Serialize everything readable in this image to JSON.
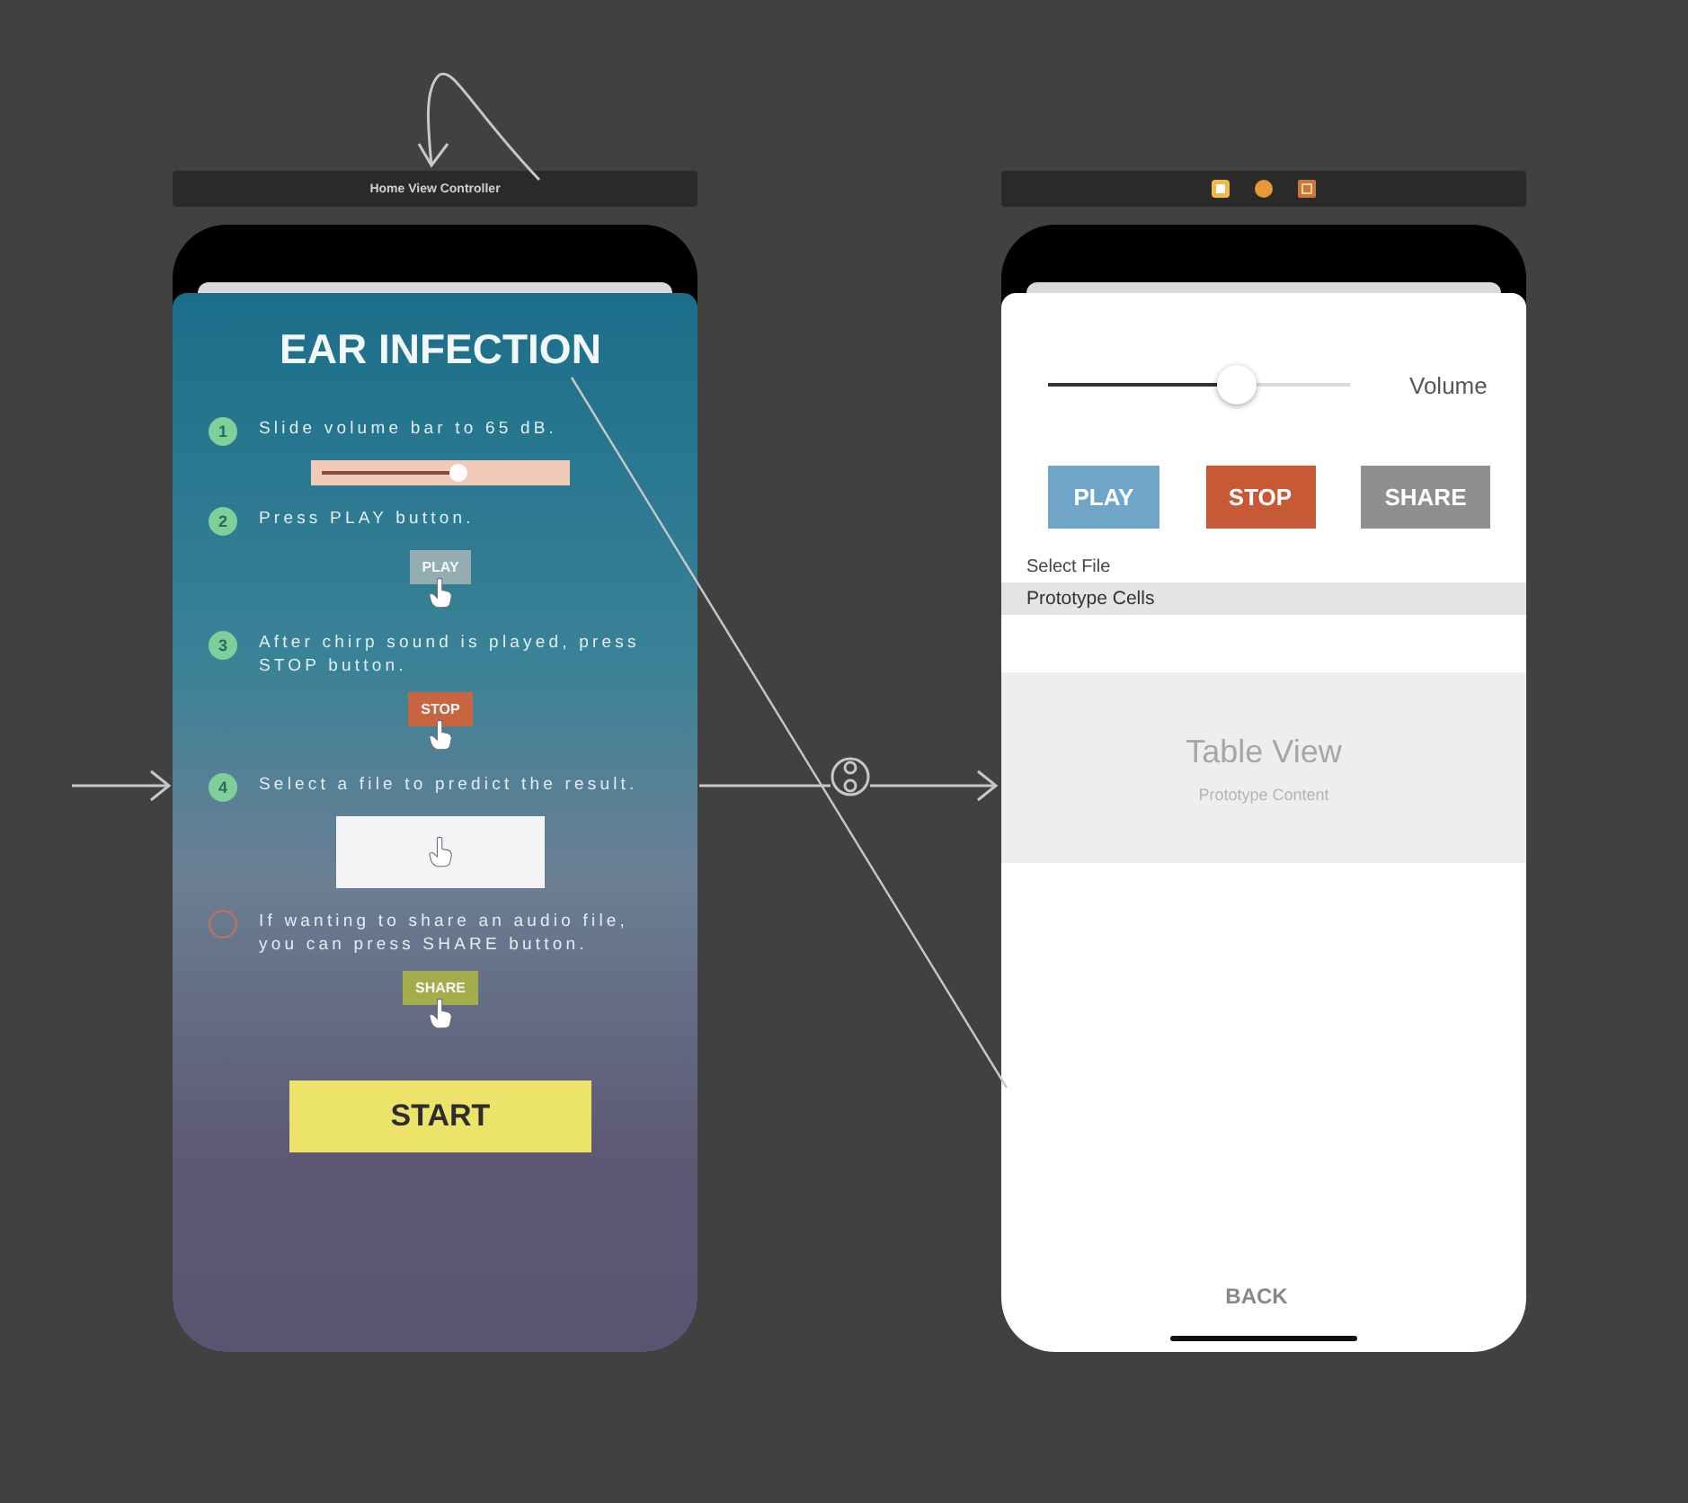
{
  "scenes": [
    {
      "kind": "instructions",
      "title": "Home View Controller",
      "heading": "EAR INFECTION",
      "steps": [
        {
          "kind": "slider",
          "number": "1",
          "color": "#7fcf9a",
          "text": "Slide volume bar to 65 dB.",
          "level": 0.57
        },
        {
          "kind": "button",
          "number": "2",
          "color": "#7fcf9a",
          "text": "Press PLAY button.",
          "button": {
            "label": "PLAY",
            "color": "#93adb3"
          }
        },
        {
          "kind": "button",
          "number": "3",
          "color": "#7fcf9a",
          "text": "After chirp sound is played, press STOP button.",
          "button": {
            "label": "STOP",
            "color": "#c8643f"
          }
        },
        {
          "kind": "file",
          "number": "4",
          "color": "#7fcf9a",
          "text": "Select a file to predict the result."
        },
        {
          "kind": "button",
          "color": "#c8705a",
          "text": "If wanting to share an audio file, you can press SHARE button.",
          "button": {
            "label": "SHARE",
            "color": "#a3ae4a"
          }
        }
      ],
      "start": "START"
    },
    {
      "kind": "player",
      "level": 0.61,
      "slider_label": "Volume",
      "buttons": [
        {
          "label": "PLAY",
          "color": "#6fa5c6"
        },
        {
          "label": "STOP",
          "color": "#c65a36"
        },
        {
          "label": "SHARE",
          "color": "#8f8f8f"
        }
      ],
      "select_label": "Select File",
      "cells_header": "Prototype Cells",
      "table_title": "Table View",
      "table_subtitle": "Prototype Content",
      "back": "BACK"
    }
  ]
}
